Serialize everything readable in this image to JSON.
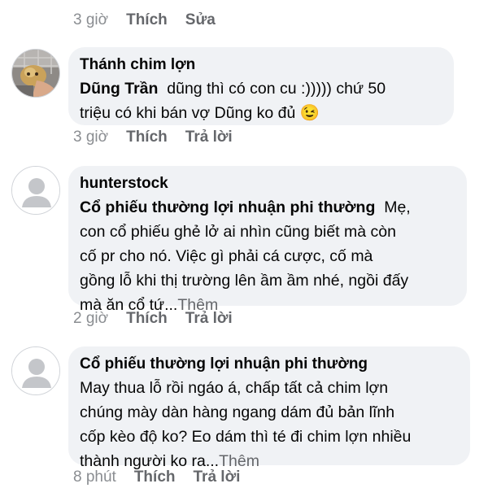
{
  "comment0": {
    "time": "3 giờ",
    "like": "Thích",
    "edit": "Sửa"
  },
  "comment1": {
    "author": "Thánh chim lợn",
    "mention": "Dũng Trần",
    "lines": [
      "dũng thì có con cu :))))) chứ 50",
      "triệu có khi bán vợ Dũng ko đủ"
    ],
    "emoji": "😉",
    "time": "3 giờ",
    "like": "Thích",
    "reply": "Trả lời"
  },
  "comment2": {
    "author": "hunterstock",
    "mention": "Cổ phiếu thường lợi nhuận phi thường",
    "first_line_tail": "Mẹ,",
    "lines": [
      "con cổ phiếu ghẻ lở ai nhìn cũng biết mà còn",
      "cố pr cho nó. Việc gì phải cá cược, cố mà",
      "gồng lỗ khi thị trường lên ầm ầm nhé, ngồi đấy",
      "mà ăn cổ tứ..."
    ],
    "more": "Thêm",
    "time": "2 giờ",
    "like": "Thích",
    "reply": "Trả lời"
  },
  "comment3": {
    "author": "Cổ phiếu thường lợi nhuận phi thường",
    "lines": [
      "May thua lỗ rồi ngáo á, chấp tất cả chim lợn",
      "chúng mày dàn hàng ngang dám đủ bản lĩnh",
      "cốp kèo độ ko? Eo dám thì té đi chim lợn nhiều",
      "thành người ko ra..."
    ],
    "more": "Thêm",
    "time": "8 phút",
    "like": "Thích",
    "reply": "Trả lời"
  }
}
